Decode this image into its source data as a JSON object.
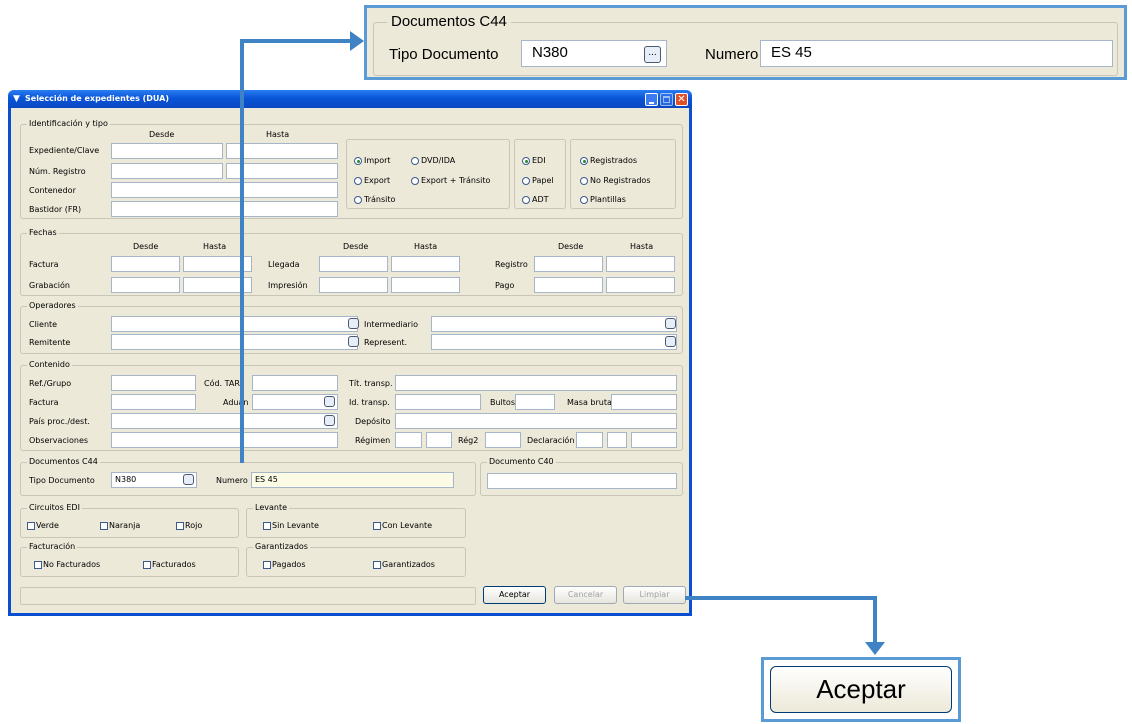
{
  "zoom_panel": {
    "legend": "Documentos C44",
    "tipo_label": "Tipo Documento",
    "tipo_value": "N380",
    "ellipsis": "...",
    "numero_label": "Numero",
    "numero_value": "ES 45"
  },
  "dialog": {
    "title": "Selección de expedientes (DUA)",
    "identificacion": {
      "legend": "Identificación y tipo",
      "desde": "Desde",
      "hasta": "Hasta",
      "rows": [
        "Expediente/Clave",
        "Núm. Registro",
        "Contenedor",
        "Bastidor (FR)"
      ],
      "tipo_radios": [
        "Import",
        "DVD/IDA",
        "Export",
        "Export + Tránsito",
        "Tránsito"
      ],
      "canal_radios": [
        "EDI",
        "Papel",
        "ADT"
      ],
      "estado_radios": [
        "Registrados",
        "No Registrados",
        "Plantillas"
      ]
    },
    "fechas": {
      "legend": "Fechas",
      "desde": "Desde",
      "hasta": "Hasta",
      "factura": "Factura",
      "grabacion": "Grabación",
      "llegada": "Llegada",
      "impresion": "Impresión",
      "registro": "Registro",
      "pago": "Pago"
    },
    "operadores": {
      "legend": "Operadores",
      "cliente": "Cliente",
      "remitente": "Remitente",
      "intermediario": "Intermediario",
      "represent": "Represent."
    },
    "contenido": {
      "legend": "Contenido",
      "ref_grupo": "Ref./Grupo",
      "cod_tarif": "Cód. TARI",
      "factura": "Factura",
      "aduana": "Aduan",
      "pais": "País proc./dest.",
      "observaciones": "Observaciones",
      "tit_transp": "Tít. transp.",
      "id_transp": "Id. transp.",
      "bultos": "Bultos",
      "masa_bruta": "Masa bruta",
      "deposito": "Depósito",
      "regimen": "Régimen",
      "reg2": "Rég2",
      "declaracion": "Declaración"
    },
    "c44": {
      "legend": "Documentos C44",
      "tipo_label": "Tipo Documento",
      "tipo_value": "N380",
      "numero_label": "Numero",
      "numero_value": "ES 45"
    },
    "c40": {
      "legend": "Documento C40"
    },
    "circuitos": {
      "legend": "Circuitos EDI",
      "items": [
        "Verde",
        "Naranja",
        "Rojo"
      ]
    },
    "levante": {
      "legend": "Levante",
      "items": [
        "Sin Levante",
        "Con Levante"
      ]
    },
    "facturacion": {
      "legend": "Facturación",
      "items": [
        "No Facturados",
        "Facturados"
      ]
    },
    "garantizados": {
      "legend": "Garantizados",
      "items": [
        "Pagados",
        "Garantizados"
      ]
    },
    "buttons": {
      "aceptar": "Aceptar",
      "cancelar": "Cancelar",
      "limpiar": "Limpiar"
    }
  },
  "zoom_button": {
    "label": "Aceptar"
  },
  "colors": {
    "accent": "#3f83c4",
    "title_bar": "#0a5fd8",
    "dialog_bg": "#ece9d8"
  }
}
